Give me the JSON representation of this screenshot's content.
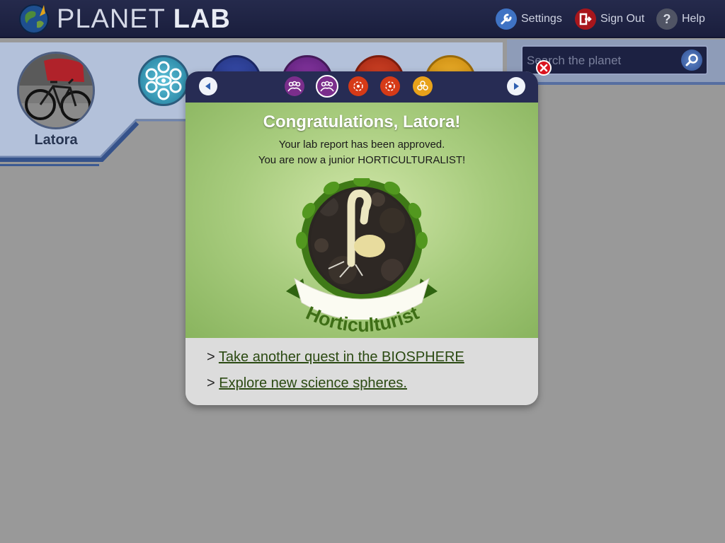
{
  "app": {
    "logo_light": "PLANET",
    "logo_bold": "LAB"
  },
  "topnav": {
    "settings": "Settings",
    "signout": "Sign Out",
    "help": "Help"
  },
  "profile": {
    "name": "Latora"
  },
  "search": {
    "placeholder": "Search the planet"
  },
  "modal": {
    "title": "Congratulations, Latora!",
    "message_line1": "Your lab report has been approved.",
    "message_line2": "You are now a junior HORTICULTURALIST!",
    "badge_label": "Horticulturist",
    "link_prefix": ">",
    "links": [
      {
        "label": "Take another quest in the BIOSPHERE"
      },
      {
        "label": "Explore new science spheres."
      }
    ]
  },
  "colors": {
    "topbar": "#1f2446",
    "header_panel": "#b0bfd8",
    "modal_green": "#a8cc7e",
    "badge_text": "#3e6e16",
    "link": "#2b4a12"
  },
  "icons": {
    "back": "arrow-left-icon",
    "forward": "arrow-right-icon",
    "close": "close-icon",
    "search": "search-icon",
    "settings": "wrench-icon",
    "signout": "sign-out-icon",
    "help": "question-icon"
  }
}
